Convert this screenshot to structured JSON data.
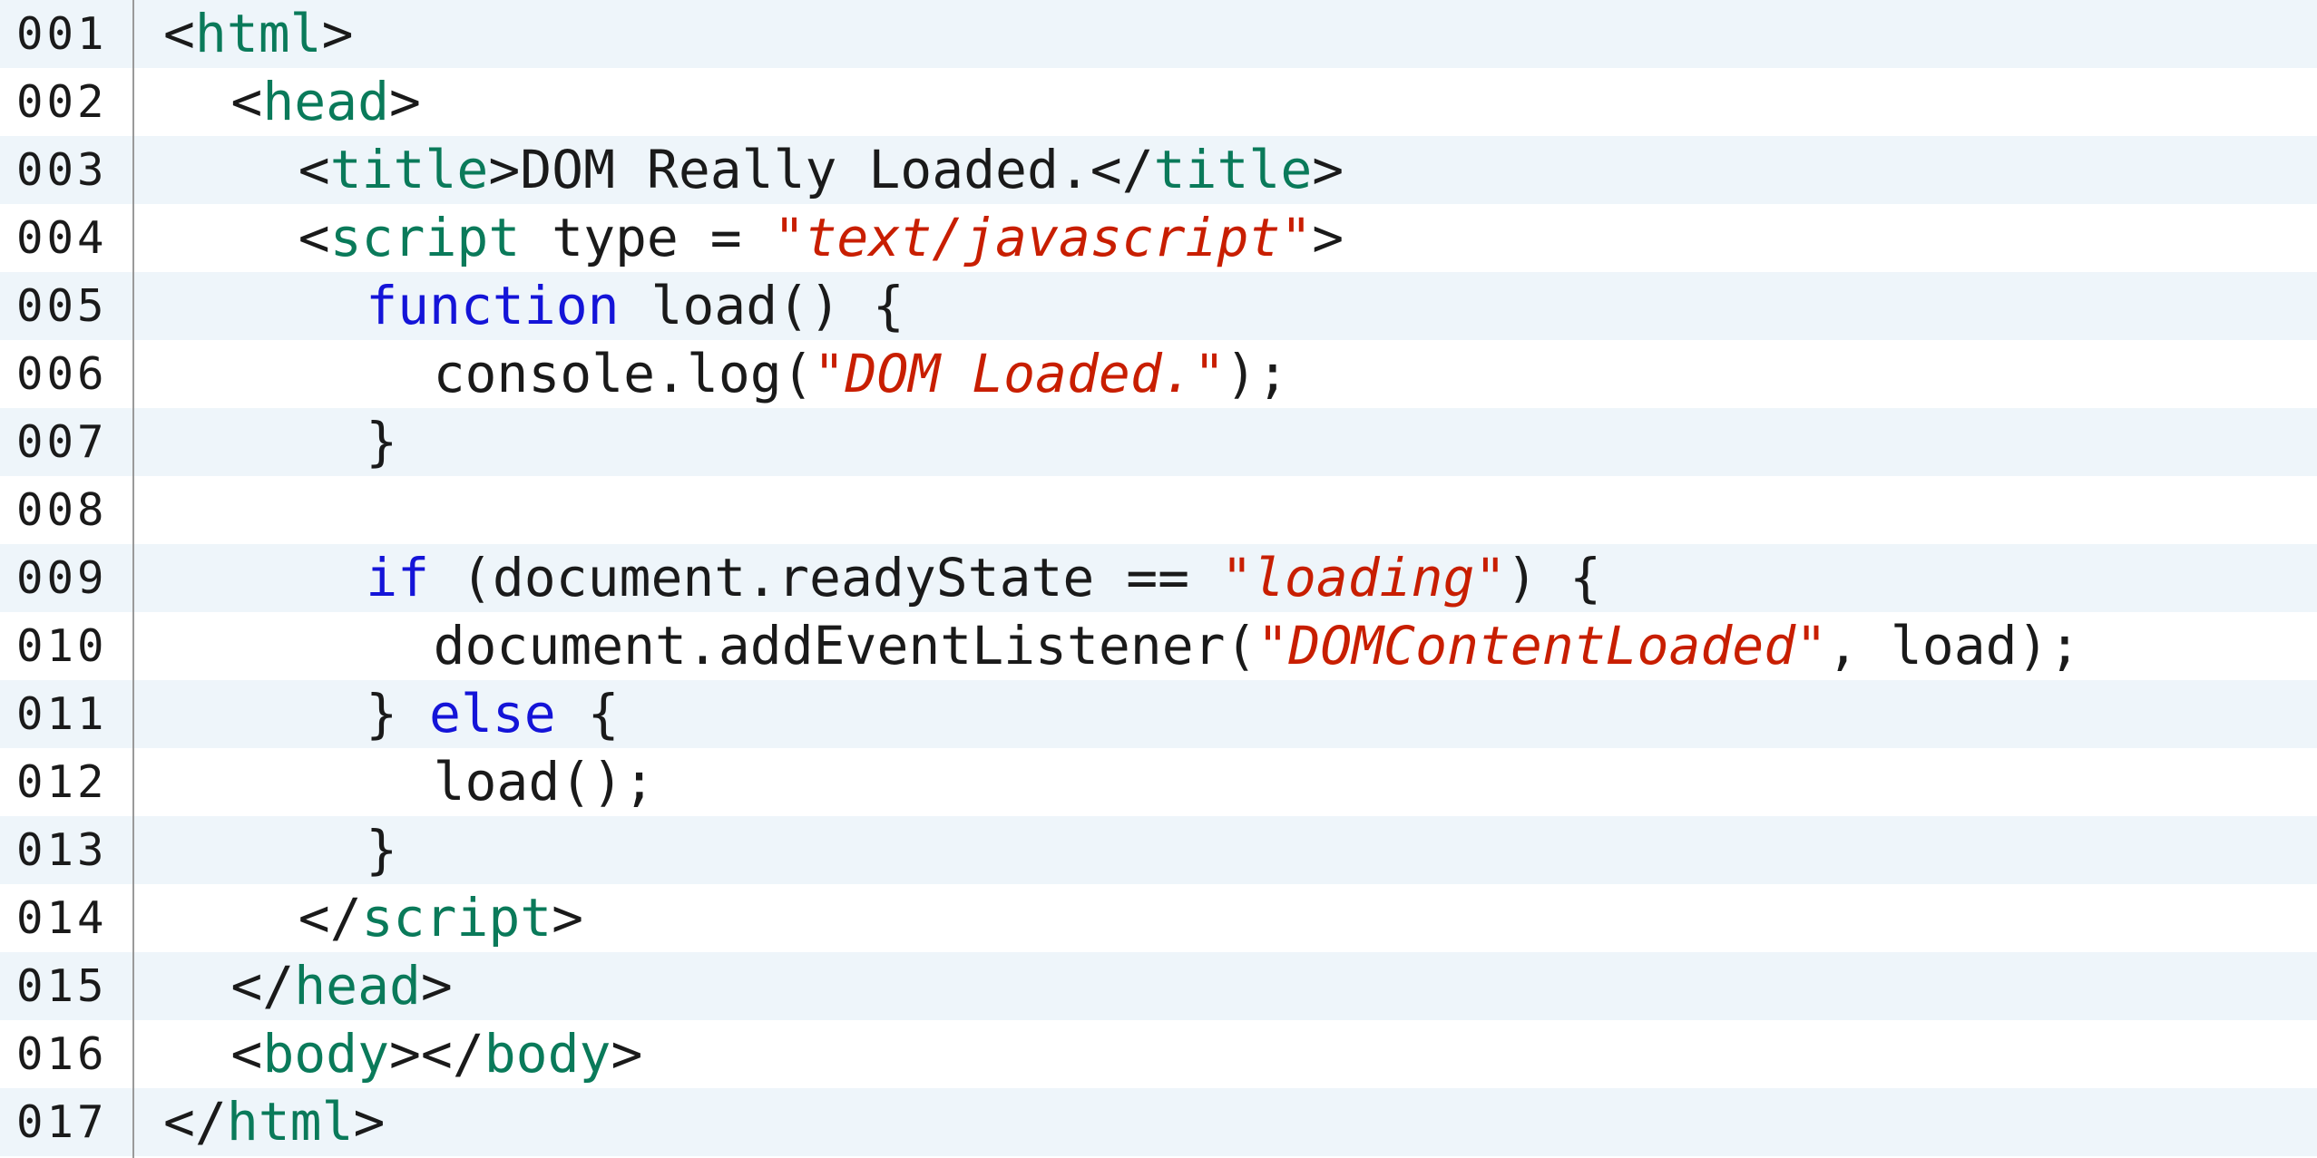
{
  "editor": {
    "lines": [
      {
        "number": "001",
        "indent": 0,
        "tokens": [
          {
            "t": "<",
            "k": "plain"
          },
          {
            "t": "html",
            "k": "tag"
          },
          {
            "t": ">",
            "k": "plain"
          }
        ]
      },
      {
        "number": "002",
        "indent": 1,
        "tokens": [
          {
            "t": "<",
            "k": "plain"
          },
          {
            "t": "head",
            "k": "tag"
          },
          {
            "t": ">",
            "k": "plain"
          }
        ]
      },
      {
        "number": "003",
        "indent": 2,
        "tokens": [
          {
            "t": "<",
            "k": "plain"
          },
          {
            "t": "title",
            "k": "tag"
          },
          {
            "t": ">DOM Really Loaded.</",
            "k": "plain"
          },
          {
            "t": "title",
            "k": "tag"
          },
          {
            "t": ">",
            "k": "plain"
          }
        ]
      },
      {
        "number": "004",
        "indent": 2,
        "tokens": [
          {
            "t": "<",
            "k": "plain"
          },
          {
            "t": "script",
            "k": "tag"
          },
          {
            "t": " type = ",
            "k": "plain"
          },
          {
            "t": "\"",
            "k": "quote"
          },
          {
            "t": "text/javascript",
            "k": "str"
          },
          {
            "t": "\"",
            "k": "quote"
          },
          {
            "t": ">",
            "k": "plain"
          }
        ]
      },
      {
        "number": "005",
        "indent": 3,
        "tokens": [
          {
            "t": "function",
            "k": "kw"
          },
          {
            "t": " load() {",
            "k": "plain"
          }
        ]
      },
      {
        "number": "006",
        "indent": 4,
        "tokens": [
          {
            "t": "console.log(",
            "k": "plain"
          },
          {
            "t": "\"",
            "k": "quote"
          },
          {
            "t": "DOM Loaded.",
            "k": "str"
          },
          {
            "t": "\"",
            "k": "quote"
          },
          {
            "t": ");",
            "k": "plain"
          }
        ]
      },
      {
        "number": "007",
        "indent": 3,
        "tokens": [
          {
            "t": "}",
            "k": "plain"
          }
        ]
      },
      {
        "number": "008",
        "indent": 0,
        "tokens": []
      },
      {
        "number": "009",
        "indent": 3,
        "tokens": [
          {
            "t": "if",
            "k": "kw"
          },
          {
            "t": " (document.readyState == ",
            "k": "plain"
          },
          {
            "t": "\"",
            "k": "quote"
          },
          {
            "t": "loading",
            "k": "str"
          },
          {
            "t": "\"",
            "k": "quote"
          },
          {
            "t": ") {",
            "k": "plain"
          }
        ]
      },
      {
        "number": "010",
        "indent": 4,
        "tokens": [
          {
            "t": "document.addEventListener(",
            "k": "plain"
          },
          {
            "t": "\"",
            "k": "quote"
          },
          {
            "t": "DOMContentLoaded",
            "k": "str"
          },
          {
            "t": "\"",
            "k": "quote"
          },
          {
            "t": ", load);",
            "k": "plain"
          }
        ]
      },
      {
        "number": "011",
        "indent": 3,
        "tokens": [
          {
            "t": "} ",
            "k": "plain"
          },
          {
            "t": "else",
            "k": "kw"
          },
          {
            "t": " {",
            "k": "plain"
          }
        ]
      },
      {
        "number": "012",
        "indent": 4,
        "tokens": [
          {
            "t": "load();",
            "k": "plain"
          }
        ]
      },
      {
        "number": "013",
        "indent": 3,
        "tokens": [
          {
            "t": "}",
            "k": "plain"
          }
        ]
      },
      {
        "number": "014",
        "indent": 2,
        "tokens": [
          {
            "t": "</",
            "k": "plain"
          },
          {
            "t": "script",
            "k": "tag"
          },
          {
            "t": ">",
            "k": "plain"
          }
        ]
      },
      {
        "number": "015",
        "indent": 1,
        "tokens": [
          {
            "t": "</",
            "k": "plain"
          },
          {
            "t": "head",
            "k": "tag"
          },
          {
            "t": ">",
            "k": "plain"
          }
        ]
      },
      {
        "number": "016",
        "indent": 1,
        "tokens": [
          {
            "t": "<",
            "k": "plain"
          },
          {
            "t": "body",
            "k": "tag"
          },
          {
            "t": "></",
            "k": "plain"
          },
          {
            "t": "body",
            "k": "tag"
          },
          {
            "t": ">",
            "k": "plain"
          }
        ]
      },
      {
        "number": "017",
        "indent": 0,
        "tokens": [
          {
            "t": "</",
            "k": "plain"
          },
          {
            "t": "html",
            "k": "tag"
          },
          {
            "t": ">",
            "k": "plain"
          }
        ]
      }
    ]
  },
  "colors": {
    "tag": "#0a7a5a",
    "keyword": "#1414d8",
    "string": "#c81e00",
    "text": "#1a1a1a",
    "stripe": "#eef5fa",
    "gutter_divider": "#9a9a9a"
  }
}
